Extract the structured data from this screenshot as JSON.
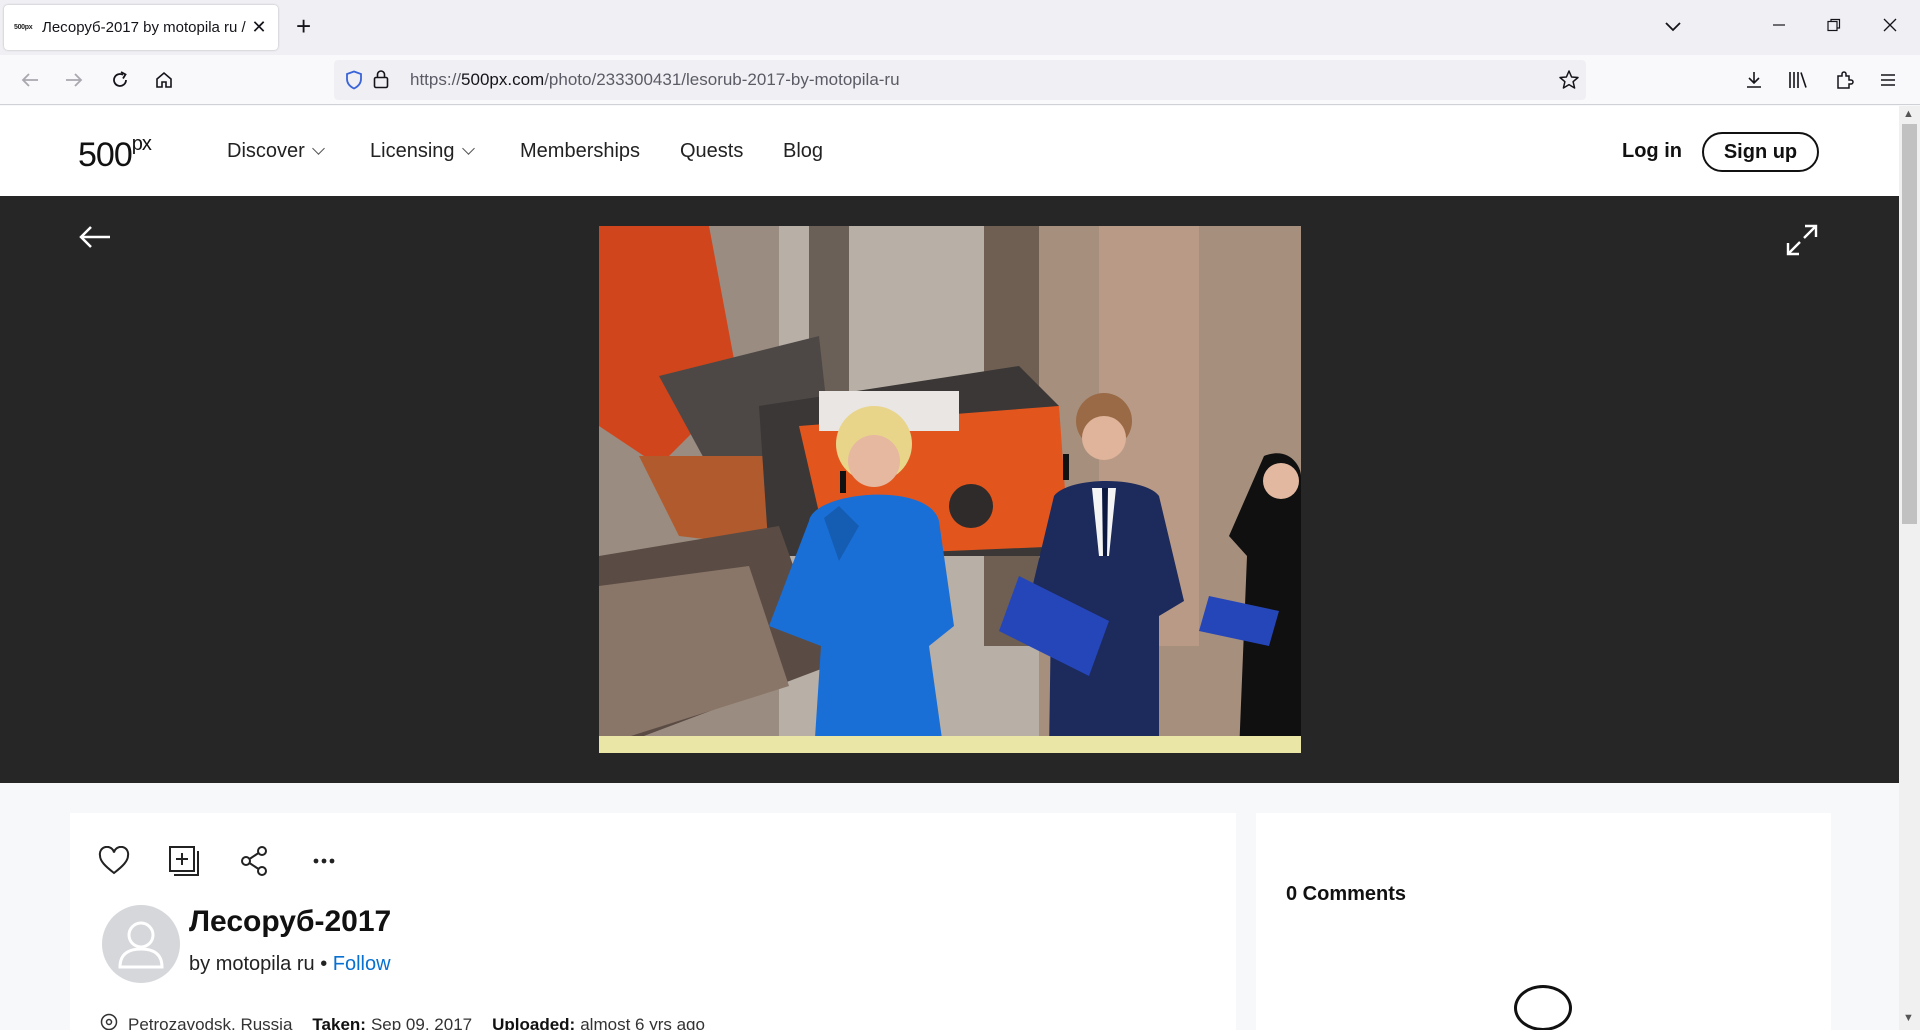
{
  "browser": {
    "tab_title": "Лесоруб-2017 by motopila ru / 500px",
    "tab_favicon": "500px",
    "new_tab_label": "+",
    "url_prefix": "https://",
    "url_host": "500px.com",
    "url_path": "/photo/233300431/lesorub-2017-by-motopila-ru"
  },
  "header": {
    "logo": "500",
    "logo_sup": "px",
    "menu": [
      "Discover",
      "Licensing",
      "Memberships",
      "Quests",
      "Blog"
    ],
    "login": "Log in",
    "signup": "Sign up"
  },
  "photo": {
    "title": "Лесоруб-2017",
    "author_prefix": "by",
    "author": "motopila ru",
    "separator": "•",
    "follow": "Follow",
    "location": "Petrozavodsk, Russia",
    "taken_label": "Taken:",
    "taken": "Sep 09, 2017",
    "uploaded_label": "Uploaded:",
    "uploaded": "almost 6 yrs ago"
  },
  "comments": {
    "label": "0 Comments"
  },
  "colors": {
    "photo_bg": "#262626",
    "link_blue": "#0870d1",
    "dress_blue": "#1a6fd6",
    "saw_orange": "#e2561e"
  }
}
